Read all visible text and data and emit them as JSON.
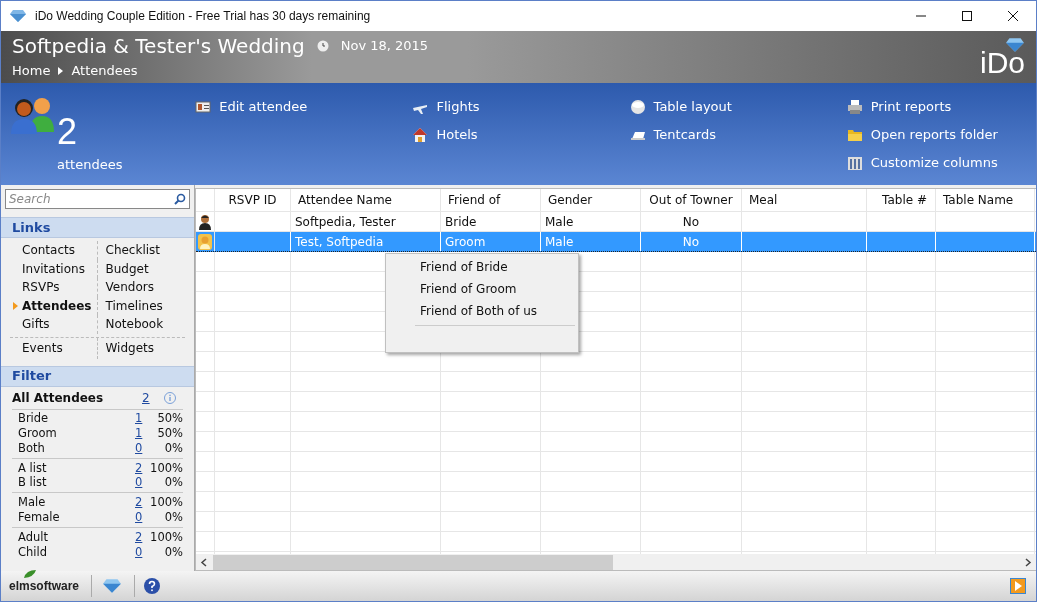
{
  "window": {
    "title": "iDo Wedding Couple Edition - Free Trial has 30 days remaining"
  },
  "header": {
    "title": "Softpedia & Tester's Wedding",
    "date": "Nov 18, 2015",
    "breadcrumb": [
      "Home",
      "Attendees"
    ],
    "logo": "iDo"
  },
  "toolbar": {
    "count": "2",
    "count_label": "attendees",
    "actions": [
      {
        "label": "Edit attendee",
        "kind": "card"
      },
      {
        "label": "Flights",
        "kind": "plane"
      },
      {
        "label": "Hotels",
        "kind": "house"
      },
      {
        "label": "Table layout",
        "kind": "table"
      },
      {
        "label": "Tentcards",
        "kind": "tentcard"
      },
      {
        "label": "Print reports",
        "kind": "printer"
      },
      {
        "label": "Open reports folder",
        "kind": "folder"
      },
      {
        "label": "Customize columns",
        "kind": "columns"
      }
    ]
  },
  "sidebar": {
    "search": {
      "placeholder": "Search"
    },
    "links": {
      "title": "Links",
      "items": [
        {
          "label": "Contacts",
          "selected": false
        },
        {
          "label": "Invitations",
          "selected": false
        },
        {
          "label": "RSVPs",
          "selected": false
        },
        {
          "label": "Attendees",
          "selected": true
        },
        {
          "label": "Gifts",
          "selected": false
        },
        {
          "label": "Checklist",
          "selected": false
        },
        {
          "label": "Budget",
          "selected": false
        },
        {
          "label": "Vendors",
          "selected": false
        },
        {
          "label": "Timelines",
          "selected": false
        },
        {
          "label": "Notebook",
          "selected": false
        }
      ],
      "extra_items": [
        {
          "label": "Events",
          "selected": false
        },
        {
          "label": "Widgets",
          "selected": false
        }
      ]
    },
    "filter": {
      "title": "Filter",
      "all": {
        "label": "All Attendees",
        "count": "2"
      },
      "groups": [
        [
          {
            "label": "Bride",
            "count": "1",
            "percent": "50%"
          },
          {
            "label": "Groom",
            "count": "1",
            "percent": "50%"
          },
          {
            "label": "Both",
            "count": "0",
            "percent": "0%"
          }
        ],
        [
          {
            "label": "A list",
            "count": "2",
            "percent": "100%"
          },
          {
            "label": "B list",
            "count": "0",
            "percent": "0%"
          }
        ],
        [
          {
            "label": "Male",
            "count": "2",
            "percent": "100%"
          },
          {
            "label": "Female",
            "count": "0",
            "percent": "0%"
          }
        ],
        [
          {
            "label": "Adult",
            "count": "2",
            "percent": "100%"
          },
          {
            "label": "Child",
            "count": "0",
            "percent": "0%"
          }
        ]
      ]
    }
  },
  "table": {
    "columns": [
      "RSVP ID",
      "Attendee Name",
      "Friend of",
      "Gender",
      "Out of Towner",
      "Meal",
      "Table #",
      "Table Name"
    ],
    "rows": [
      {
        "kind": "male",
        "selected": false,
        "cells": [
          "",
          "Softpedia, Tester",
          "Bride",
          "Male",
          "No",
          "",
          "",
          ""
        ]
      },
      {
        "kind": "female",
        "selected": true,
        "cells": [
          "",
          "Test, Softpedia",
          "Groom",
          "Male",
          "No",
          "",
          "",
          ""
        ]
      }
    ]
  },
  "context_menu": {
    "items": [
      "Friend of Bride",
      "Friend of Groom",
      "Friend of Both of us"
    ]
  },
  "footer": {
    "brand": "elmsoftware"
  }
}
